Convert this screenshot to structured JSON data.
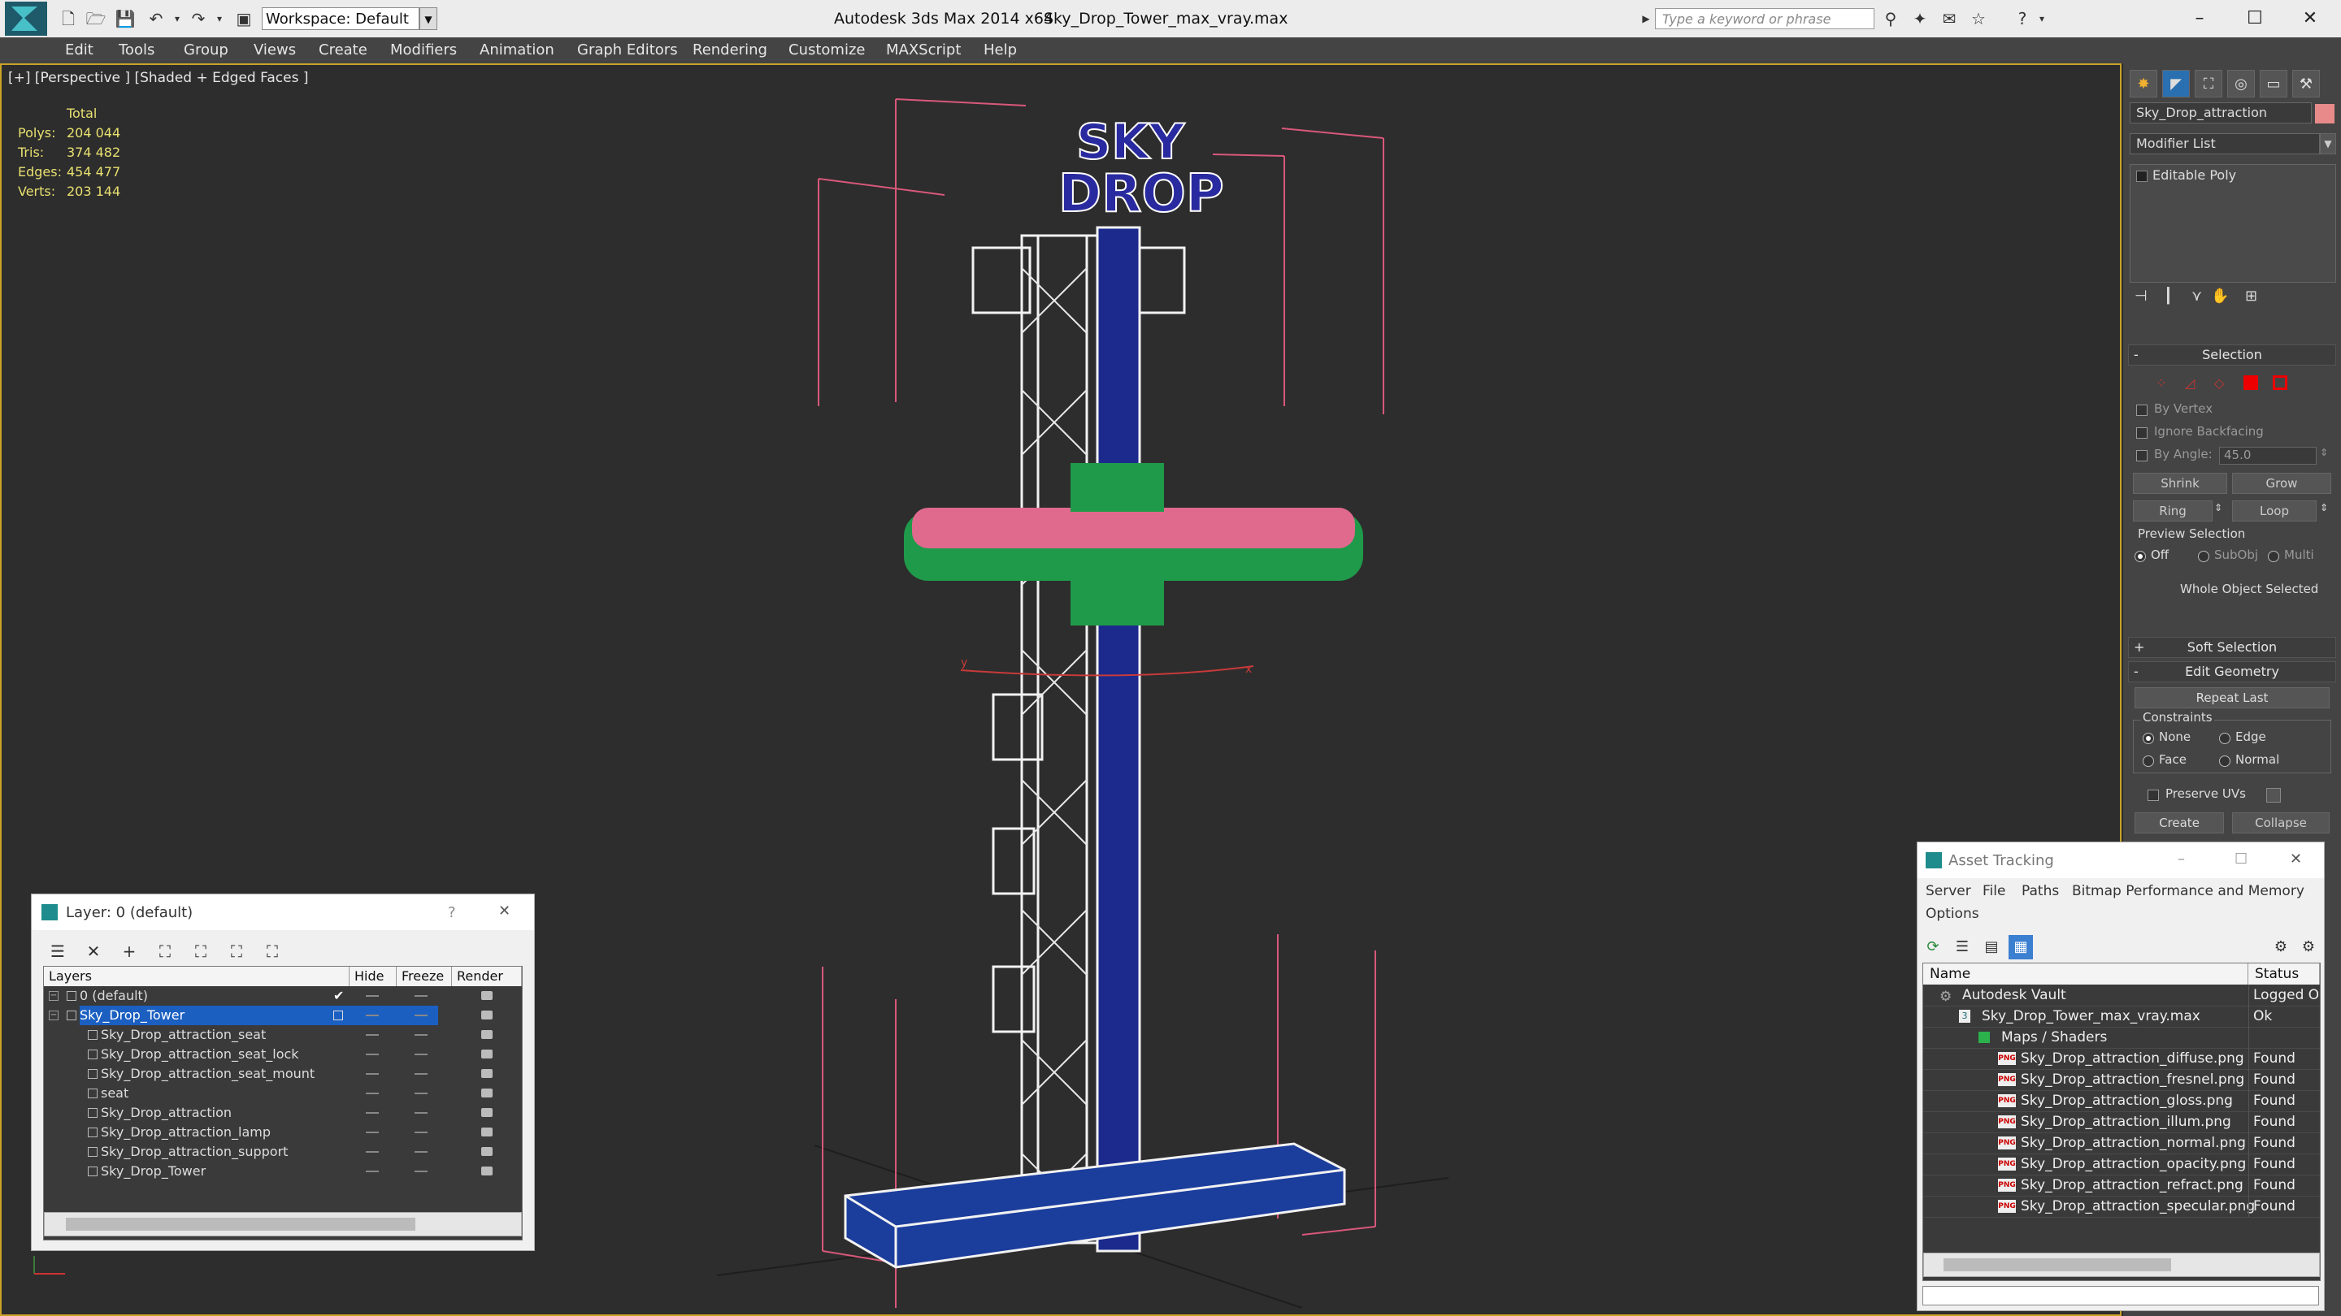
{
  "window": {
    "app_title": "Autodesk 3ds Max  2014 x64",
    "file_title": "Sky_Drop_Tower_max_vray.max",
    "workspace": "Workspace: Default",
    "search_placeholder": "Type a keyword or phrase"
  },
  "menu": [
    "Edit",
    "Tools",
    "Group",
    "Views",
    "Create",
    "Modifiers",
    "Animation",
    "Graph Editors",
    "Rendering",
    "Customize",
    "MAXScript",
    "Help"
  ],
  "viewport": {
    "label": "[+] [Perspective ] [Shaded + Edged Faces ]",
    "stats": {
      "header": "Total",
      "rows": [
        {
          "label": "Polys:",
          "value": "204 044"
        },
        {
          "label": "Tris:",
          "value": "374 482"
        },
        {
          "label": "Edges:",
          "value": "454 477"
        },
        {
          "label": "Verts:",
          "value": "203 144"
        }
      ]
    },
    "sign_line1": "SKY",
    "sign_line2": "DROP",
    "axis_x": "x",
    "axis_y": "y"
  },
  "command_panel": {
    "object_name": "Sky_Drop_attraction",
    "object_color": "#e88a8a",
    "modifier_list": "Modifier List",
    "stack_item": "Editable Poly",
    "selection": {
      "title": "Selection",
      "by_vertex": "By Vertex",
      "ignore_backfacing": "Ignore Backfacing",
      "by_angle": "By Angle:",
      "angle_value": "45.0",
      "shrink": "Shrink",
      "grow": "Grow",
      "ring": "Ring",
      "loop": "Loop",
      "preview_selection": "Preview Selection",
      "preview_off": "Off",
      "preview_subobj": "SubObj",
      "preview_multi": "Multi",
      "status": "Whole Object Selected"
    },
    "soft_selection": "Soft Selection",
    "edit_geometry": {
      "title": "Edit Geometry",
      "repeat_last": "Repeat Last",
      "constraints": "Constraints",
      "none": "None",
      "edge": "Edge",
      "face": "Face",
      "normal": "Normal",
      "preserve_uvs": "Preserve UVs",
      "create": "Create",
      "collapse": "Collapse"
    }
  },
  "layer_dialog": {
    "title": "Layer: 0 (default)",
    "help": "?",
    "columns": [
      "Layers",
      "Hide",
      "Freeze",
      "Render"
    ],
    "rows": [
      {
        "name": "0 (default)",
        "indent": 0,
        "selected": false,
        "current": true
      },
      {
        "name": "Sky_Drop_Tower",
        "indent": 0,
        "selected": true,
        "current": false
      },
      {
        "name": "Sky_Drop_attraction_seat",
        "indent": 1,
        "selected": false,
        "current": false
      },
      {
        "name": "Sky_Drop_attraction_seat_lock",
        "indent": 1,
        "selected": false,
        "current": false
      },
      {
        "name": "Sky_Drop_attraction_seat_mount",
        "indent": 1,
        "selected": false,
        "current": false
      },
      {
        "name": "seat",
        "indent": 1,
        "selected": false,
        "current": false
      },
      {
        "name": "Sky_Drop_attraction",
        "indent": 1,
        "selected": false,
        "current": false
      },
      {
        "name": "Sky_Drop_attraction_lamp",
        "indent": 1,
        "selected": false,
        "current": false
      },
      {
        "name": "Sky_Drop_attraction_support",
        "indent": 1,
        "selected": false,
        "current": false
      },
      {
        "name": "Sky_Drop_Tower",
        "indent": 1,
        "selected": false,
        "current": false
      }
    ]
  },
  "asset_tracking": {
    "title": "Asset Tracking",
    "menu": [
      "Server",
      "File",
      "Paths",
      "Bitmap Performance and Memory",
      "Options"
    ],
    "columns": [
      "Name",
      "Status"
    ],
    "rows": [
      {
        "name": "Autodesk Vault",
        "status": "Logged O",
        "indent": 0,
        "kind": "vault"
      },
      {
        "name": "Sky_Drop_Tower_max_vray.max",
        "status": "Ok",
        "indent": 1,
        "kind": "max"
      },
      {
        "name": "Maps / Shaders",
        "status": "",
        "indent": 2,
        "kind": "maps"
      },
      {
        "name": "Sky_Drop_attraction_diffuse.png",
        "status": "Found",
        "indent": 3,
        "kind": "png"
      },
      {
        "name": "Sky_Drop_attraction_fresnel.png",
        "status": "Found",
        "indent": 3,
        "kind": "png"
      },
      {
        "name": "Sky_Drop_attraction_gloss.png",
        "status": "Found",
        "indent": 3,
        "kind": "png"
      },
      {
        "name": "Sky_Drop_attraction_illum.png",
        "status": "Found",
        "indent": 3,
        "kind": "png"
      },
      {
        "name": "Sky_Drop_attraction_normal.png",
        "status": "Found",
        "indent": 3,
        "kind": "png"
      },
      {
        "name": "Sky_Drop_attraction_opacity.png",
        "status": "Found",
        "indent": 3,
        "kind": "png"
      },
      {
        "name": "Sky_Drop_attraction_refract.png",
        "status": "Found",
        "indent": 3,
        "kind": "png"
      },
      {
        "name": "Sky_Drop_attraction_specular.png",
        "status": "Found",
        "indent": 3,
        "kind": "png"
      }
    ],
    "png_label": "PNG"
  }
}
